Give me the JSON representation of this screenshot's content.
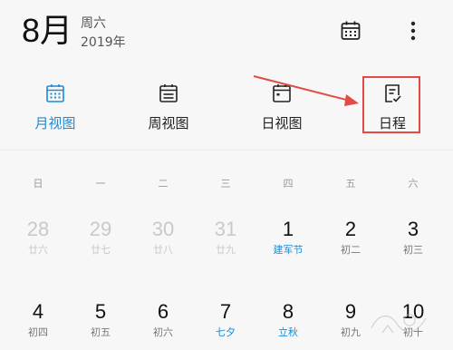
{
  "header": {
    "month": "8月",
    "weekday": "周六",
    "year": "2019年",
    "calendar_icon": "calendar-icon",
    "more_icon": "more-vertical-icon"
  },
  "views": [
    {
      "label": "月视图",
      "icon": "month-view-icon",
      "active": true
    },
    {
      "label": "周视图",
      "icon": "week-view-icon",
      "active": false
    },
    {
      "label": "日视图",
      "icon": "day-view-icon",
      "active": false
    },
    {
      "label": "日程",
      "icon": "schedule-icon",
      "active": false
    }
  ],
  "weekdays": [
    "日",
    "一",
    "二",
    "三",
    "四",
    "五",
    "六"
  ],
  "calendar_rows": [
    [
      {
        "day": "28",
        "lunar": "廿六",
        "prev": true
      },
      {
        "day": "29",
        "lunar": "廿七",
        "prev": true
      },
      {
        "day": "30",
        "lunar": "廿八",
        "prev": true
      },
      {
        "day": "31",
        "lunar": "廿九",
        "prev": true
      },
      {
        "day": "1",
        "lunar": "建军节",
        "festival": true
      },
      {
        "day": "2",
        "lunar": "初二"
      },
      {
        "day": "3",
        "lunar": "初三"
      }
    ],
    [
      {
        "day": "4",
        "lunar": "初四"
      },
      {
        "day": "5",
        "lunar": "初五"
      },
      {
        "day": "6",
        "lunar": "初六"
      },
      {
        "day": "7",
        "lunar": "七夕",
        "festival": true
      },
      {
        "day": "8",
        "lunar": "立秋",
        "festival": true
      },
      {
        "day": "9",
        "lunar": "初九"
      },
      {
        "day": "10",
        "lunar": "初十"
      }
    ]
  ],
  "colors": {
    "accent": "#1a8bd8",
    "annotation": "#e24b45",
    "muted": "#c9c9c9"
  }
}
